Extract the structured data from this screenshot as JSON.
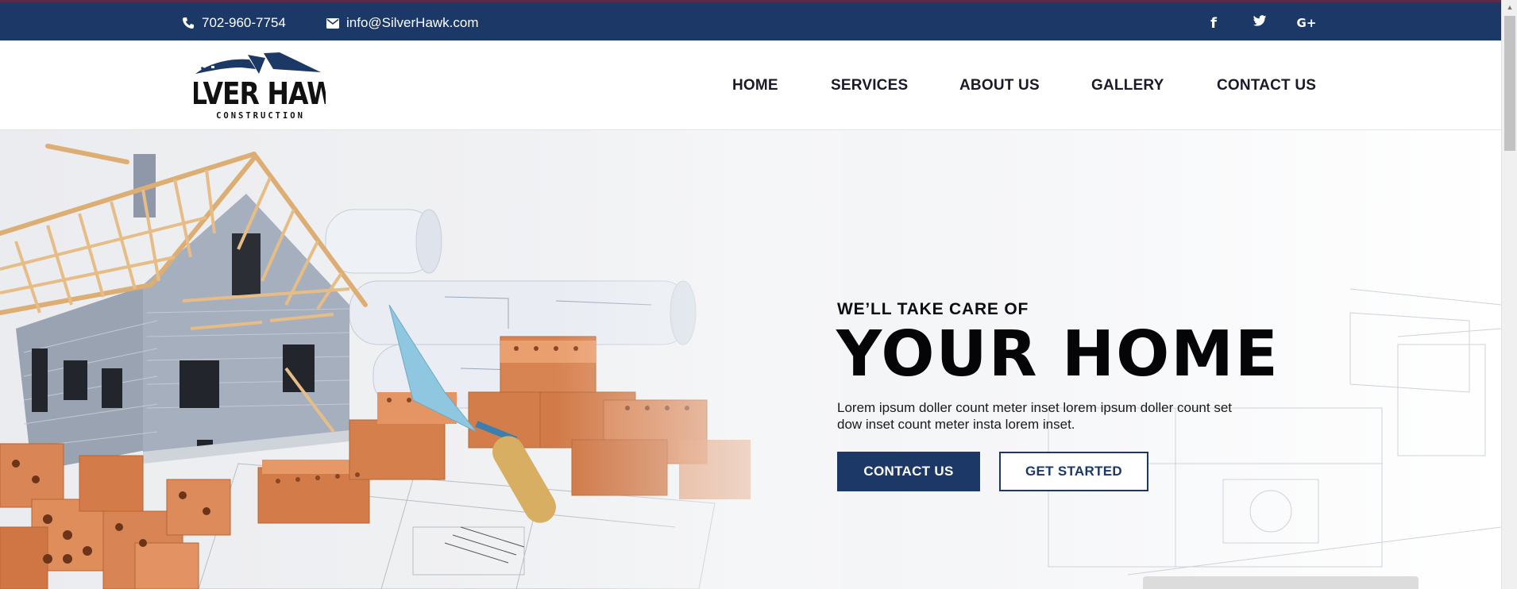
{
  "topbar": {
    "phone": "702-960-7754",
    "email": "info@SilverHawk.com",
    "social": [
      {
        "icon": "facebook-icon",
        "glyph": "f"
      },
      {
        "icon": "twitter-icon",
        "glyph": "t"
      },
      {
        "icon": "google-plus-icon",
        "glyph": "G+"
      }
    ]
  },
  "logo": {
    "line1": "SILVER HAWK",
    "line2": "CONSTRUCTION"
  },
  "nav": {
    "items": [
      "HOME",
      "SERVICES",
      "ABOUT US",
      "GALLERY",
      "CONTACT US"
    ]
  },
  "hero": {
    "eyebrow": "WE’LL TAKE CARE OF",
    "headline": "YOUR HOME",
    "description": "Lorem ipsum doller count meter inset lorem ipsum doller count set dow inset count meter insta lorem inset.",
    "primary_button": "CONTACT US",
    "secondary_button": "GET STARTED"
  },
  "colors": {
    "brand_navy": "#1b3866",
    "text_dark": "#050508",
    "brick": "#d9824f",
    "roof_wood": "#e3b77d"
  }
}
